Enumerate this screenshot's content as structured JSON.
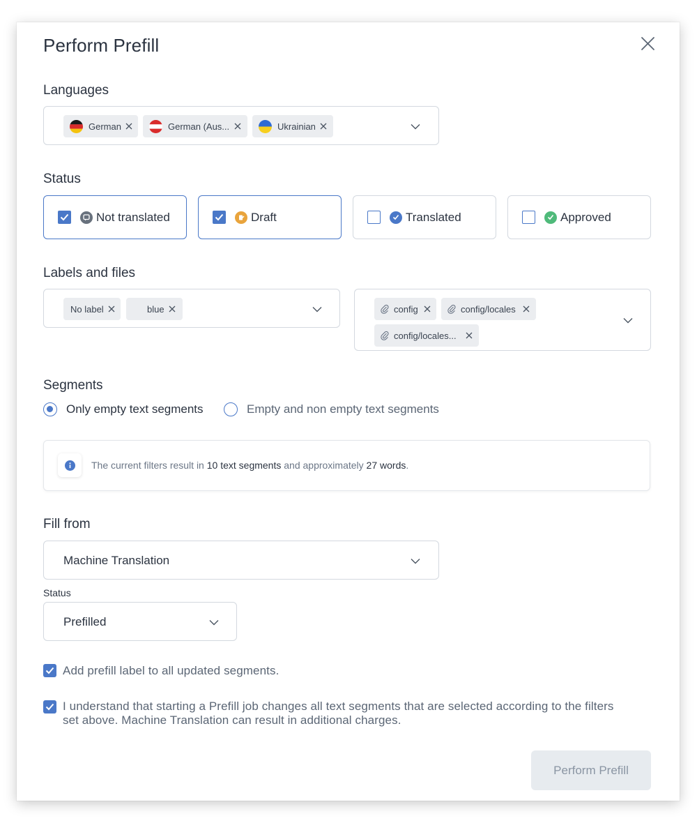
{
  "dialog": {
    "title": "Perform Prefill",
    "close_icon": "close-icon"
  },
  "languages": {
    "label": "Languages",
    "chips": [
      {
        "label": "German",
        "flag": "flag-germany"
      },
      {
        "label": "German (Aus...",
        "flag": "flag-austria"
      },
      {
        "label": "Ukrainian",
        "flag": "flag-ukraine"
      }
    ]
  },
  "status": {
    "label": "Status",
    "options": [
      {
        "label": "Not translated",
        "checked": true,
        "icon": "speech-bubble-icon",
        "color": "#68717d"
      },
      {
        "label": "Draft",
        "checked": true,
        "icon": "pencil-icon",
        "color": "#e9a43c"
      },
      {
        "label": "Translated",
        "checked": false,
        "icon": "check-circle-icon",
        "color": "#4a78c8"
      },
      {
        "label": "Approved",
        "checked": false,
        "icon": "double-check-icon",
        "color": "#4fba7a"
      }
    ]
  },
  "labels_files": {
    "label": "Labels and files",
    "label_chips": [
      "No label",
      "blue"
    ],
    "file_chips": [
      "config",
      "config/locales",
      "config/locales..."
    ]
  },
  "segments": {
    "label": "Segments",
    "options": [
      {
        "label": "Only empty text segments",
        "selected": true
      },
      {
        "label": "Empty and non empty text segments",
        "selected": false
      }
    ]
  },
  "info": {
    "prefix": "The current filters result in ",
    "count": "10 text segments",
    "middle": " and approximately ",
    "words": "27 words",
    "suffix": "."
  },
  "fill_from": {
    "label": "Fill from",
    "value": "Machine Translation"
  },
  "prefill_status": {
    "label": "Status",
    "value": "Prefilled"
  },
  "checkboxes": {
    "add_label": "Add prefill label to all updated segments.",
    "add_label_checked": true,
    "understand_line1": "I understand that starting a Prefill job changes all text segments that are selected according to the filters",
    "understand_line2": "set above. Machine Translation can result in additional charges.",
    "understand_checked": true
  },
  "footer": {
    "submit_label": "Perform Prefill"
  },
  "colors": {
    "accent": "#4a78c8",
    "chip_bg": "#ebedf0",
    "button_disabled_bg": "#e7ebef"
  }
}
